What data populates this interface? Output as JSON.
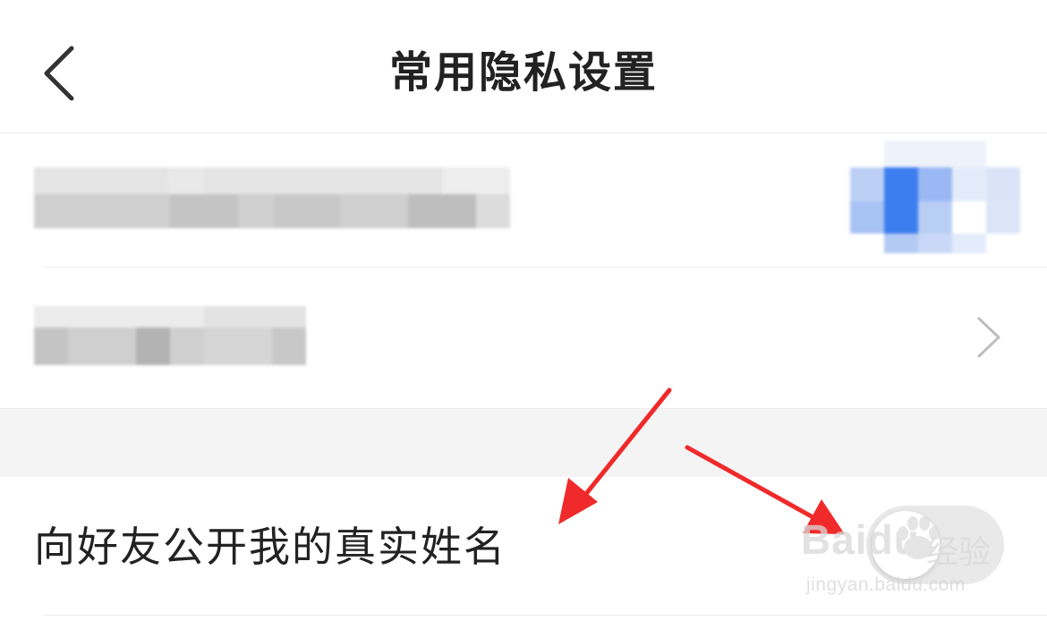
{
  "header": {
    "title": "常用隐私设置",
    "back_icon": "chevron-left-icon"
  },
  "rows": [
    {
      "label_redacted": true,
      "accessory": "redacted-icon"
    },
    {
      "label_redacted": true,
      "accessory": "chevron-right-icon"
    }
  ],
  "privacy_option": {
    "label": "向好友公开我的真实姓名",
    "toggle_state": "off"
  },
  "watermark": {
    "brand": "Bai",
    "brand_suffix": "du",
    "brand_cn": "经验",
    "url": "jingyan.baidu.com"
  },
  "colors": {
    "arrow": "#f02a2a",
    "toggle_off": "#e9e9e9",
    "section_gap": "#f4f4f4",
    "text_primary": "#222222"
  }
}
